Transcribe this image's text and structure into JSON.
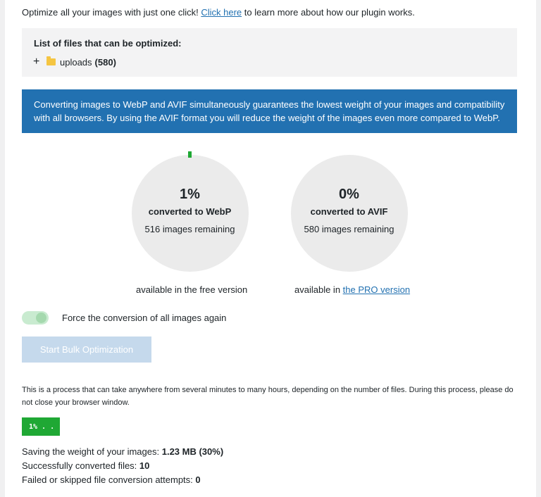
{
  "intro": {
    "text_before": "Optimize all your images with just one click!",
    "link": "Click here",
    "text_after": "to learn more about how our plugin works."
  },
  "files": {
    "title": "List of files that can be optimized:",
    "expand_symbol": "+",
    "folder_icon": "folder-icon",
    "folder_name": "uploads",
    "folder_count": "(580)"
  },
  "notice": "Converting images to WebP and AVIF simultaneously guarantees the lowest weight of your images and compatibility with all browsers. By using the AVIF format you will reduce the weight of the images even more compared to WebP.",
  "webp": {
    "percent": "1%",
    "label": "converted to WebP",
    "remaining": "516 images remaining",
    "availability": "available in the free version"
  },
  "avif": {
    "percent": "0%",
    "label": "converted to AVIF",
    "remaining": "580 images remaining",
    "availability_prefix": "available in",
    "availability_link": "the PRO version"
  },
  "force_toggle": {
    "label": "Force the conversion of all images again",
    "state": "on"
  },
  "start_button": "Start Bulk Optimization",
  "process_note": "This is a process that can take anywhere from several minutes to many hours, depending on the number of files. During this process, please do not close your browser window.",
  "progress": "1% . .",
  "stats": {
    "saving_label": "Saving the weight of your images:",
    "saving_value": "1.23 MB (30%)",
    "converted_label": "Successfully converted files:",
    "converted_value": "10",
    "failed_label": "Failed or skipped file conversion attempts:",
    "failed_value": "0"
  },
  "colors": {
    "accent_blue": "#2271b1",
    "progress_green": "#1fa834",
    "circle_bg": "#ebebeb",
    "disabled_button": "#c5d9ec"
  }
}
